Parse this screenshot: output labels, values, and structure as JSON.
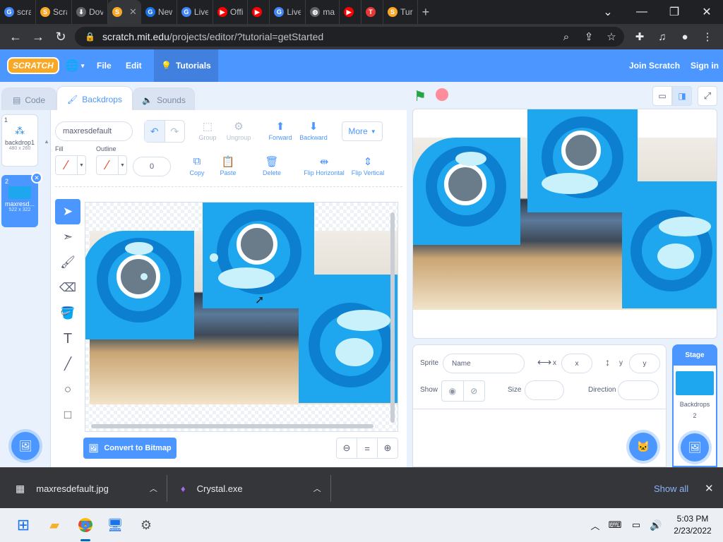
{
  "browser": {
    "tabs": [
      {
        "title": "scra",
        "icon": "google-icon",
        "color": "#4285f4",
        "glyph": "G"
      },
      {
        "title": "Scra",
        "icon": "scratch-icon",
        "color": "#f9a825",
        "glyph": "S"
      },
      {
        "title": "Dov",
        "icon": "download-icon",
        "color": "#5f6368",
        "glyph": "⬇"
      },
      {
        "title": "",
        "icon": "scratch-icon",
        "color": "#f9a825",
        "glyph": "S",
        "active": true
      },
      {
        "title": "New",
        "icon": "chrome-icon",
        "color": "#1a73e8",
        "glyph": "G"
      },
      {
        "title": "Live",
        "icon": "google-icon",
        "color": "#4285f4",
        "glyph": "G"
      },
      {
        "title": "Offi",
        "icon": "youtube-icon",
        "color": "#ff0000",
        "glyph": "▶"
      },
      {
        "title": "",
        "icon": "youtube-icon",
        "color": "#ff0000",
        "glyph": "▶"
      },
      {
        "title": "Live",
        "icon": "google-icon",
        "color": "#4285f4",
        "glyph": "G"
      },
      {
        "title": "ma",
        "icon": "globe-icon",
        "color": "#5f6368",
        "glyph": "◍"
      },
      {
        "title": "",
        "icon": "youtube-icon",
        "color": "#ff0000",
        "glyph": "▶"
      },
      {
        "title": "",
        "icon": "tinkercad-icon",
        "color": "#e53935",
        "glyph": "T"
      },
      {
        "title": "Tur",
        "icon": "scratch-icon",
        "color": "#f9a825",
        "glyph": "S"
      }
    ],
    "url_host": "scratch.mit.edu",
    "url_path": "/projects/editor/?tutorial=getStarted"
  },
  "menubar": {
    "logo": "SCRATCH",
    "file": "File",
    "edit": "Edit",
    "tutorials": "Tutorials",
    "join": "Join Scratch",
    "signin": "Sign in"
  },
  "editor_tabs": {
    "code": "Code",
    "backdrops": "Backdrops",
    "sounds": "Sounds"
  },
  "backdrops": [
    {
      "num": "1",
      "name": "backdrop1",
      "size": "480 x 260"
    },
    {
      "num": "2",
      "name": "maxresd...",
      "size": "522 x 322"
    }
  ],
  "paint": {
    "name_value": "maxresdefault",
    "group": "Group",
    "ungroup": "Ungroup",
    "forward": "Forward",
    "backward": "Backward",
    "more": "More",
    "fill": "Fill",
    "outline": "Outline",
    "outline_width": "0",
    "copy": "Copy",
    "paste": "Paste",
    "delete": "Delete",
    "flip_h": "Flip Horizontal",
    "flip_v": "Flip Vertical",
    "convert": "Convert to Bitmap",
    "zoom_reset": "="
  },
  "sprite_info": {
    "sprite_label": "Sprite",
    "name_placeholder": "Name",
    "x_label": "x",
    "x_placeholder": "x",
    "y_label": "y",
    "y_placeholder": "y",
    "show_label": "Show",
    "size_label": "Size",
    "direction_label": "Direction"
  },
  "stage_target": {
    "title": "Stage",
    "backdrops_label": "Backdrops",
    "backdrops_count": "2"
  },
  "downloads": {
    "file1": "maxresdefault.jpg",
    "file2": "Crystal.exe",
    "show_all": "Show all"
  },
  "taskbar": {
    "time": "5:03 PM",
    "date": "2/23/2022"
  },
  "colors": {
    "scratch_blue": "#4c97ff",
    "card_blue": "#1ea7ef"
  }
}
